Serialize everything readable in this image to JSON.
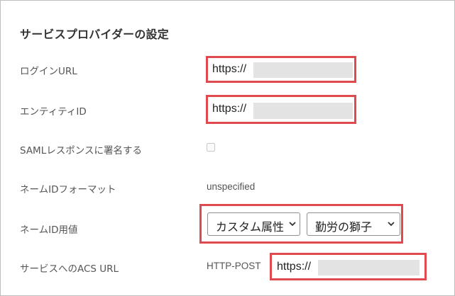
{
  "section": {
    "title": "サービスプロバイダーの設定"
  },
  "rows": {
    "login_url": {
      "label": "ログインURL",
      "value": "https://"
    },
    "entity_id": {
      "label": "エンティティID",
      "value": "https://"
    },
    "saml_sign": {
      "label": "SAMLレスポンスに署名する",
      "checked": false
    },
    "nameid_format": {
      "label": "ネームIDフォーマット",
      "value": "unspecified"
    },
    "nameid_value": {
      "label": "ネームID用値",
      "attribute_select": "カスタム属性",
      "source_select": "勤労の獅子"
    },
    "acs_url": {
      "label": "サービスへのACS URL",
      "binding": "HTTP-POST",
      "value": "https://"
    }
  },
  "icons": {
    "select_arrow": "chevron-down-icon",
    "checkbox": "checkbox-icon"
  },
  "colors": {
    "highlight": "#e04a4f",
    "redaction": "#e3e3e3",
    "label_text": "#555555",
    "title_text": "#333333"
  }
}
